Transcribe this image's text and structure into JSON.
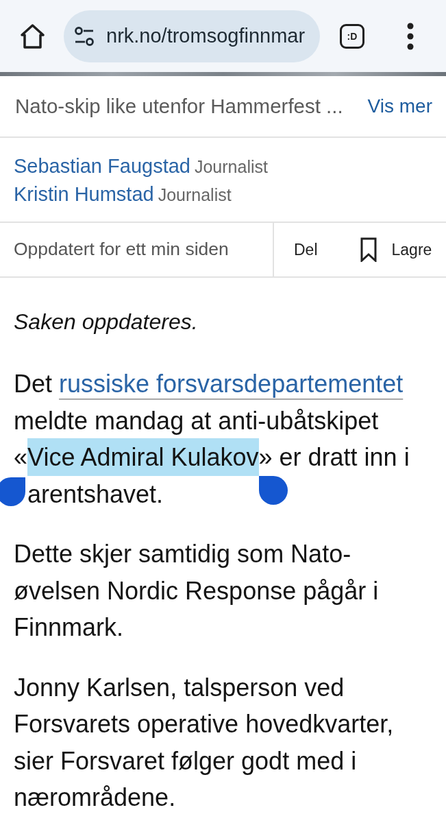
{
  "browser": {
    "url": "nrk.no/tromsogfinnmar",
    "tab_switcher": ":D"
  },
  "caption": {
    "text": "Nato-skip like utenfor Hammerfest ...",
    "more_link": "Vis mer"
  },
  "authors": [
    {
      "name": "Sebastian Faugstad",
      "role": "Journalist"
    },
    {
      "name": "Kristin Humstad",
      "role": "Journalist"
    }
  ],
  "meta": {
    "updated": "Oppdatert for ett min siden",
    "share": "Del",
    "save": "Lagre"
  },
  "body": [
    {
      "kind": "note",
      "segments": [
        {
          "kind": "text",
          "text": "Saken oppdateres."
        }
      ]
    },
    {
      "kind": "paragraph",
      "segments": [
        {
          "kind": "text",
          "text": "Det "
        },
        {
          "kind": "link",
          "text": "russiske forsvarsdepartementet"
        },
        {
          "kind": "text",
          "text": " meldte mandag at anti-ubåtskipet «"
        },
        {
          "kind": "selection",
          "text": "Vice Admiral Kulakov"
        },
        {
          "kind": "text",
          "text": "» er dratt inn i "
        },
        {
          "kind": "covered",
          "text": "arentshavet."
        }
      ]
    },
    {
      "kind": "paragraph",
      "segments": [
        {
          "kind": "text",
          "text": "Dette skjer samtidig som Nato-øvelsen Nordic Response pågår i Finnmark."
        }
      ]
    },
    {
      "kind": "paragraph",
      "segments": [
        {
          "kind": "text",
          "text": "Jonny Karlsen, talsperson ved Forsvarets operative hovedkvarter, sier Forsvaret følger godt med i nærområdene."
        }
      ]
    }
  ]
}
